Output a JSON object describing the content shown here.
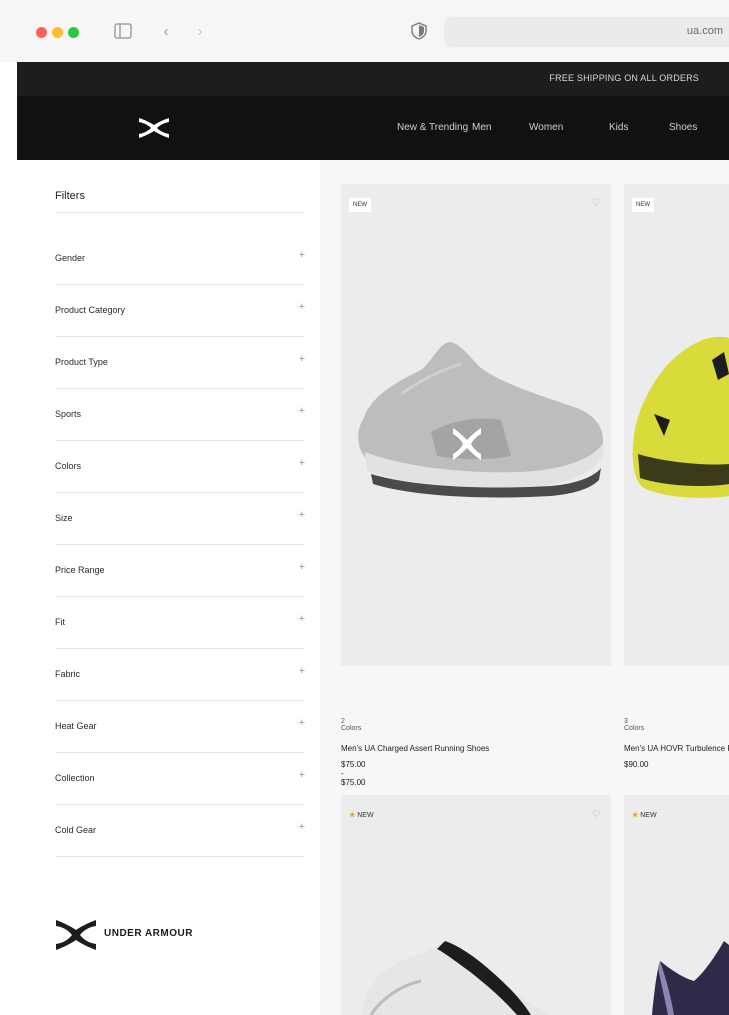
{
  "browser": {
    "back_glyph": "‹",
    "forward_glyph": "›",
    "address_text": "ua.com",
    "icons": [
      "sidebar-toggle-icon",
      "chevron-left-icon",
      "chevron-right-icon",
      "privacy-shield-icon"
    ]
  },
  "promo": {
    "text": "FREE SHIPPING ON ALL ORDERS"
  },
  "header": {
    "nav": [
      "New & Trending",
      "Men",
      "Women",
      "Kids",
      "Shoes"
    ]
  },
  "sidebar": {
    "title": "Filters",
    "filters": [
      "Gender",
      "Product Category",
      "Product Type",
      "Sports",
      "Colors",
      "Size",
      "Price Range",
      "Fit",
      "Fabric",
      "Heat Gear",
      "Collection",
      "Cold Gear"
    ],
    "plus_glyph": "+",
    "brand_wordmark": "UNDER ARMOUR"
  },
  "products": [
    {
      "badge": "NEW",
      "colors": "2 Colors",
      "name": "Men's UA Charged Assert Running Shoes",
      "price": "$75.00 - $75.00",
      "favorite_glyph": "♡"
    },
    {
      "badge": "NEW",
      "colors": "3 Colors",
      "name": "Men's UA HOVR Turbulence Running Shoes",
      "price": "$90.00",
      "favorite_glyph": "♡"
    },
    {
      "badge": "NEW",
      "star_glyph": "★",
      "favorite_glyph": "♡"
    },
    {
      "badge": "NEW",
      "star_glyph": "★"
    }
  ],
  "colors": {
    "header_bg": "#111111",
    "promo_bg": "#1d1d1d",
    "card_bg": "#ececec",
    "accent_star": "#e0a526"
  }
}
